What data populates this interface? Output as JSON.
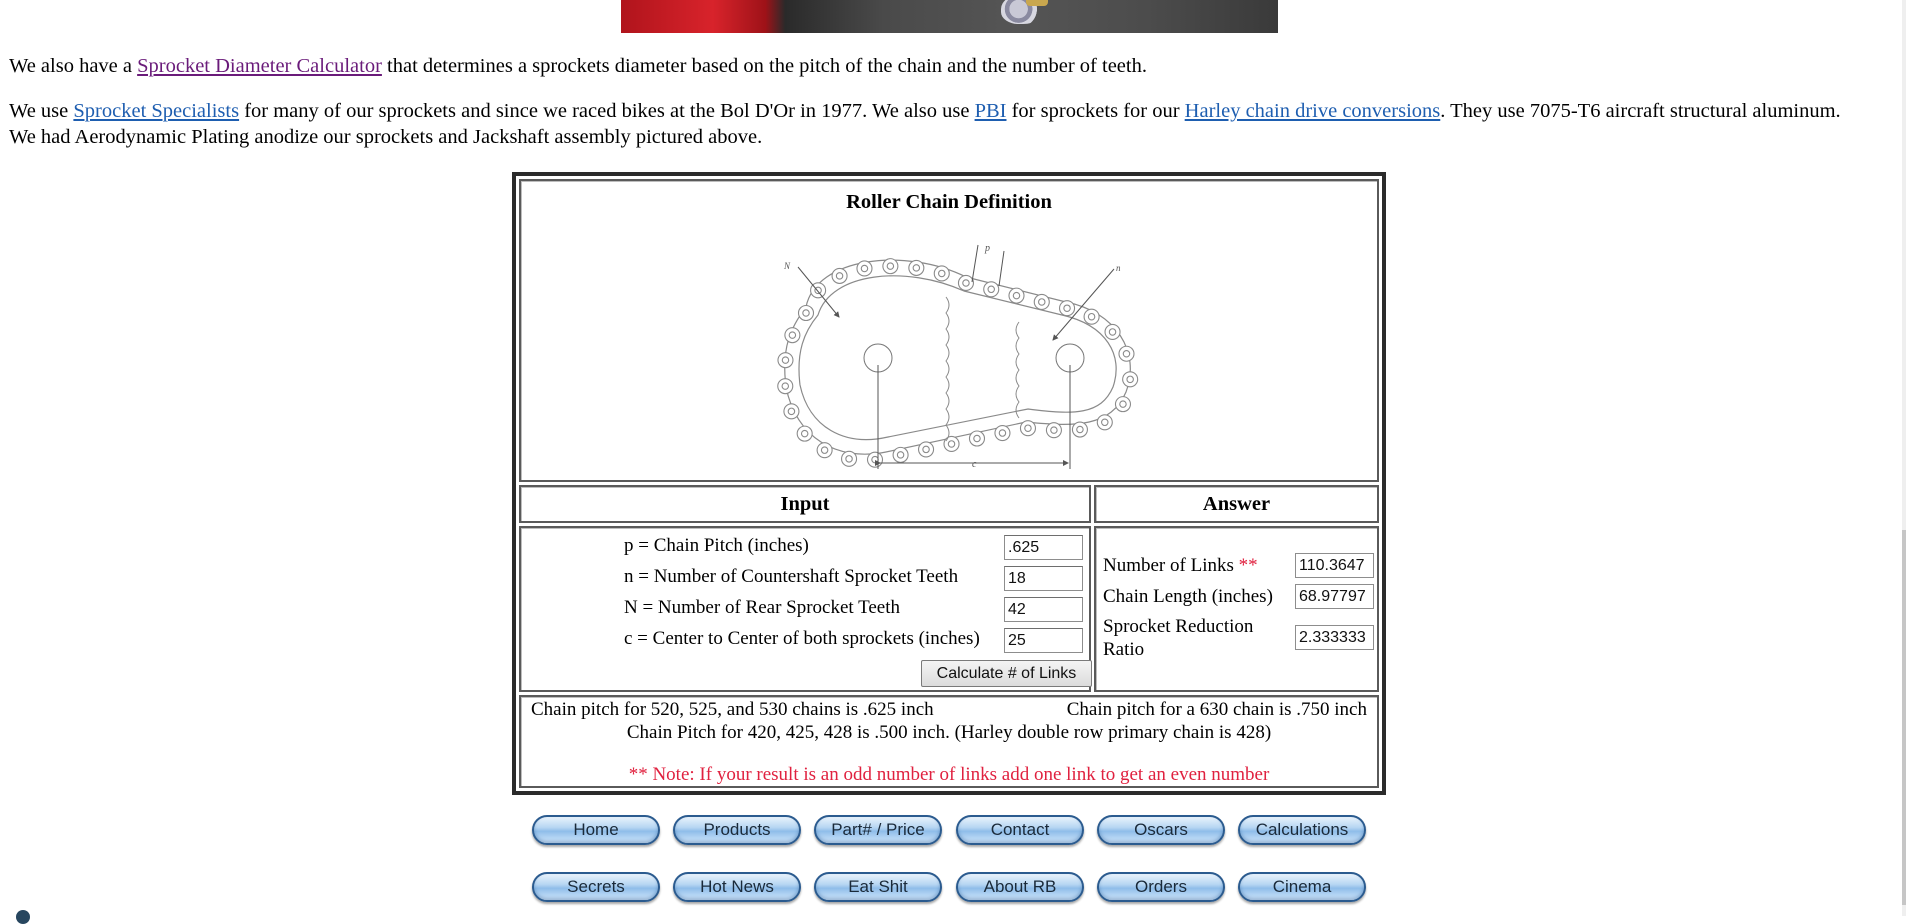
{
  "header_image": {
    "alt": "sprocket and chain photo",
    "icon": "chain-link-photo"
  },
  "paragraphs": {
    "p1": {
      "before": "We also have a ",
      "link": "Sprocket Diameter Calculator",
      "after": " that determines a sprockets diameter based on the pitch of the chain and the number of teeth."
    },
    "p2": {
      "t1": "We use ",
      "link1": "Sprocket Specialists",
      "t2": " for many of our sprockets and since we raced bikes at the Bol D'Or in 1977. We also use ",
      "link2": "PBI",
      "t3": " for sprockets for our ",
      "link3": "Harley chain drive conversions",
      "t4": ". They use 7075-T6 aircraft structural aluminum. We had Aerodynamic Plating anodize our sprockets and Jackshaft assembly pictured above."
    }
  },
  "calculator": {
    "title": "Roller Chain Definition",
    "diagram_labels": {
      "big_sprocket": "N",
      "small_sprocket": "n",
      "pitch": "p",
      "center": "c"
    },
    "input_header": "Input",
    "answer_header": "Answer",
    "inputs": [
      {
        "label": "p = Chain Pitch (inches)",
        "value": ".625"
      },
      {
        "label": "n = Number of Countershaft Sprocket Teeth",
        "value": "18"
      },
      {
        "label": "N = Number of Rear Sprocket Teeth",
        "value": "42"
      },
      {
        "label": "c = Center to Center of both sprockets (inches)",
        "value": "25"
      }
    ],
    "calculate_button": "Calculate # of Links",
    "answers": [
      {
        "label": "Number of Links",
        "marker": "**",
        "value": "110.3647"
      },
      {
        "label": "Chain Length (inches)",
        "value": "68.97797"
      },
      {
        "label": "Sprocket Reduction Ratio",
        "value": "2.333333"
      }
    ],
    "notes": {
      "left": "Chain pitch for 520, 525, and 530 chains is .625 inch",
      "right": "Chain pitch for a 630 chain is .750 inch",
      "center": "Chain Pitch for 420, 425, 428 is .500 inch. (Harley double row primary chain is 428)",
      "warning": "** Note: If your result is an odd number of links add one link to get an even number"
    }
  },
  "nav": {
    "row1": [
      "Home",
      "Products",
      "Part# / Price",
      "Contact",
      "Oscars",
      "Calculations"
    ],
    "row2": [
      "Secrets",
      "Hot News",
      "Eat Shit",
      "About RB",
      "Orders",
      "Cinema"
    ]
  },
  "colors": {
    "visited_link": "#6a1b7a",
    "link": "#1e5eb0",
    "note_red": "#e0213f",
    "table_border": "#2b2b2b",
    "nav_button": "#8fbde9"
  }
}
